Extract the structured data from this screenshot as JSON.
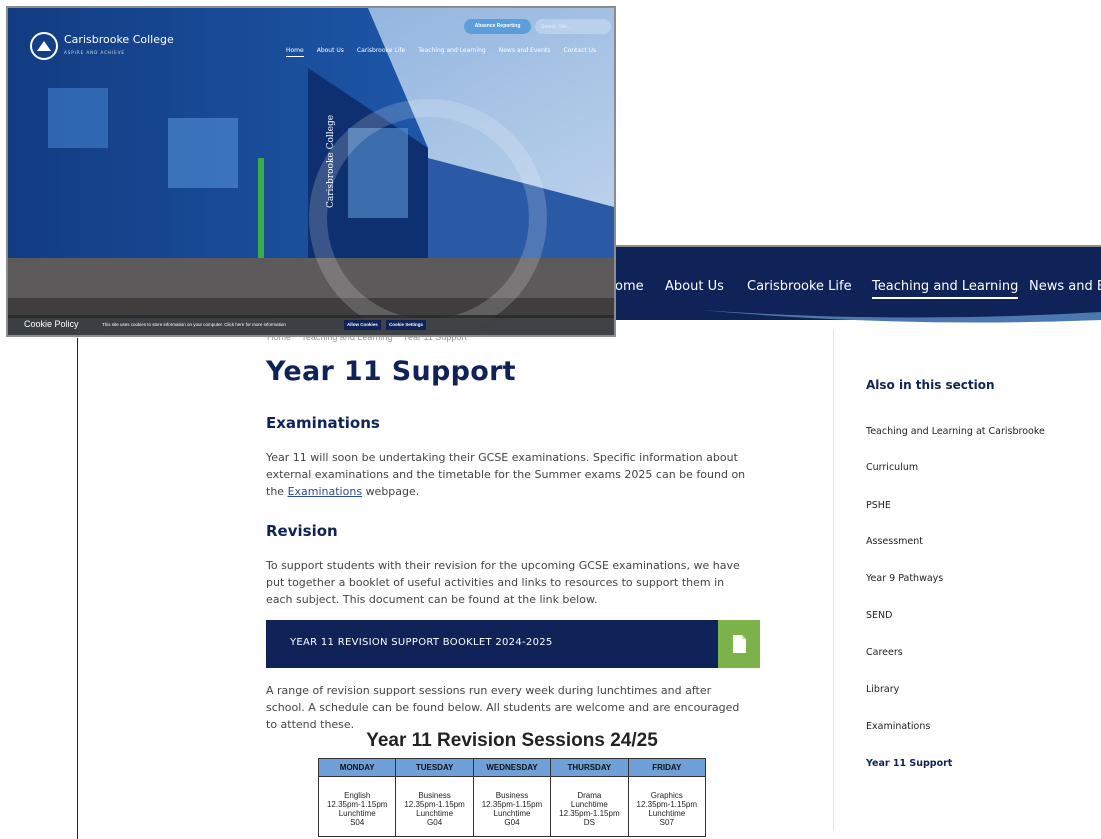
{
  "main_nav": {
    "items": [
      "ome",
      "About Us",
      "Carisbrooke Life",
      "Teaching and Learning",
      "News and Ev"
    ],
    "active_index": 3
  },
  "breadcrumb": [
    "Home",
    "Teaching and Learning",
    "Year 11 Support"
  ],
  "page": {
    "title": "Year 11 Support",
    "examinations_heading": "Examinations",
    "examinations_text": "Year 11 will soon be undertaking their GCSE examinations. Specific information about external examinations and the timetable for the Summer exams 2025 can be found on the",
    "examinations_link": "Examinations",
    "examinations_suffix": "webpage.",
    "revision_heading": "Revision",
    "revision_text": "To support students with their revision for the upcoming GCSE examinations, we have put together a booklet of useful activities and links to resources to support them in each subject. This document can be found at the link below.",
    "booklet_label": "YEAR 11 REVISION SUPPORT BOOKLET 2024-2025",
    "sessions_text": "A range of revision support sessions run every week during lunchtimes and after school. A schedule can be found below. All students are welcome and are encouraged to attend these."
  },
  "schedule": {
    "title": "Year 11 Revision Sessions 24/25",
    "days": [
      "MONDAY",
      "TUESDAY",
      "WEDNESDAY",
      "THURSDAY",
      "FRIDAY"
    ],
    "cells": [
      [
        "English",
        "12.35pm-1.15pm",
        "Lunchtime",
        "S04"
      ],
      [
        "Business",
        "12.35pm-1.15pm",
        "Lunchtime",
        "G04"
      ],
      [
        "Business",
        "12.35pm-1.15pm",
        "Lunchtime",
        "G04"
      ],
      [
        "Drama",
        "Lunchtime",
        "12.35pm-1.15pm",
        "DS"
      ],
      [
        "Graphics",
        "12.35pm-1.15pm",
        "Lunchtime",
        "S07"
      ]
    ]
  },
  "sidebar": {
    "title": "Also in this section",
    "items": [
      "Teaching and Learning at Carisbrooke",
      "Curriculum",
      "PSHE",
      "Assessment",
      "Year 9 Pathways",
      "SEND",
      "Careers",
      "Library",
      "Examinations",
      "Year 11 Support"
    ],
    "current_index": 9
  },
  "overlay": {
    "logo_name": "Carisbrooke College",
    "logo_sub": "ASPIRE AND ACHIEVE",
    "absence_button": "Absence Reporting",
    "search_placeholder": "Search Site...",
    "nav": [
      "Home",
      "About Us",
      "Carisbrooke Life",
      "Teaching and Learning",
      "News and Events",
      "Contact Us"
    ],
    "nav_active_index": 0,
    "building_sign": "Carisbrooke College",
    "cookie_title": "Cookie Policy",
    "cookie_text": "This site uses cookies to store information on your computer. Click here for more information",
    "allow_cookies": "Allow Cookies",
    "cookie_settings": "Cookie Settings"
  },
  "colors": {
    "navy": "#0f2358",
    "green": "#7bb34a",
    "schedule_header": "#6fa0d8",
    "absence_blue": "#5b9ed9"
  }
}
